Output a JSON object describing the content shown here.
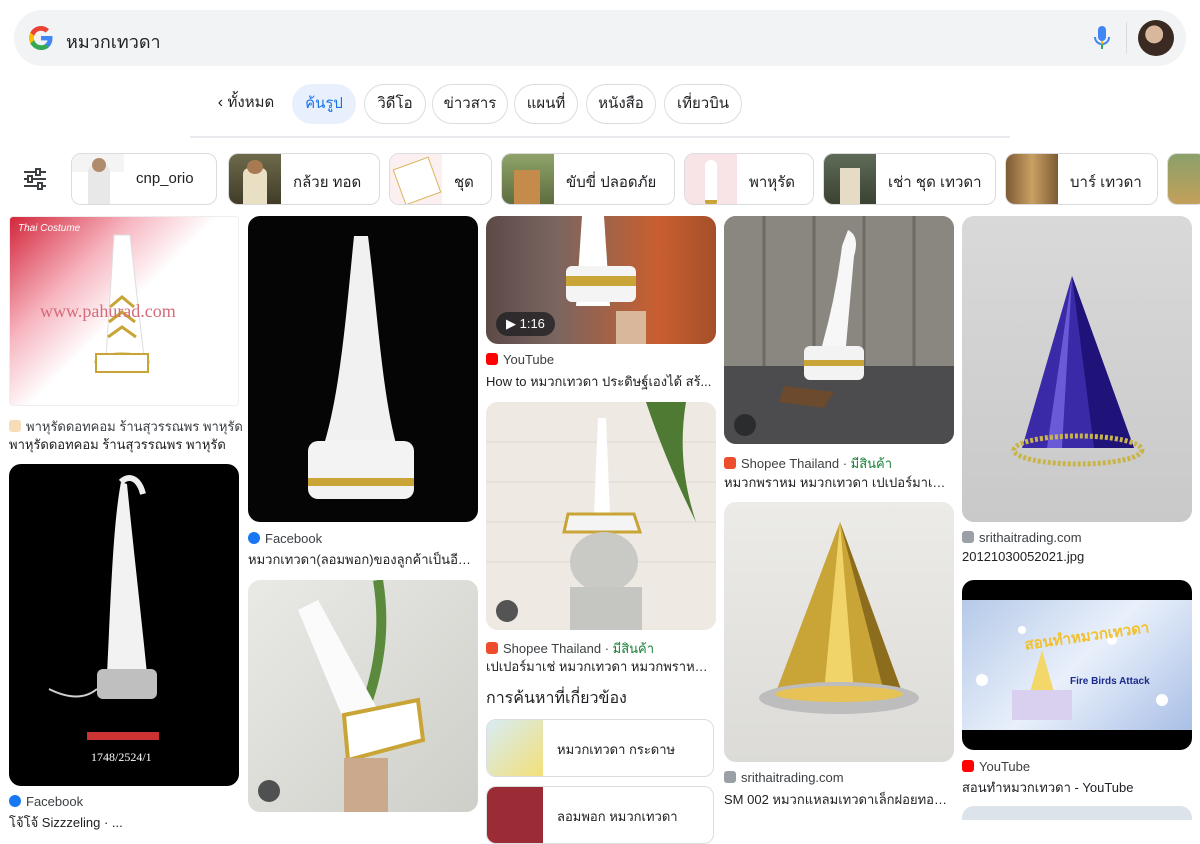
{
  "search": {
    "query": "หมวกเทวดา"
  },
  "tabs": [
    {
      "label": "ทั้งหมด"
    },
    {
      "label": "ค้นรูป"
    },
    {
      "label": "วิดีโอ"
    },
    {
      "label": "ข่าวสาร"
    },
    {
      "label": "แผนที่"
    },
    {
      "label": "หนังสือ"
    },
    {
      "label": "เที่ยวบิน"
    }
  ],
  "chips": [
    {
      "label": "cnp_orio"
    },
    {
      "label": "กล้วย ทอด"
    },
    {
      "label": "ชุด"
    },
    {
      "label": "ขับขี่ ปลอดภัย"
    },
    {
      "label": "พาหุรัด"
    },
    {
      "label": "เช่า ชุด เทวดา"
    },
    {
      "label": "บาร์ เทวดา"
    }
  ],
  "results": {
    "r1": {
      "source": "พาหุรัดดอทคอม ร้านสุวรรณพร พาหุรัด",
      "caption": "พาหุรัดดอทคอม ร้านสุวรรณพร พาหุรัด",
      "overlay_brand": "Thai Costume",
      "overlay_url": "www.pahurad.com"
    },
    "r2": {
      "source": "Facebook",
      "caption": "โจ้โจ้ Sizzzeling · ...",
      "overlay_code": "1748/2524/1"
    },
    "r3": {
      "source": "Facebook",
      "caption": "หมวกเทวดา(ลอมพอก)ของลูกค้าเป็นอีกห..."
    },
    "r5": {
      "source": "YouTube",
      "caption": "How to หมวกเทวดา ประดิษฐ์เองได้ สร้...",
      "duration": "1:16"
    },
    "r6": {
      "source": "Shopee Thailand",
      "stock": "มีสินค้า",
      "caption": "เปเปอร์มาเช่ หมวกเทวดา หมวกพราหม..."
    },
    "r7": {
      "source": "Shopee Thailand",
      "stock": "มีสินค้า",
      "caption": "หมวกพราหม หมวกเทวดา เปเปอร์มาเช่ |..."
    },
    "r8": {
      "source": "srithaitrading.com",
      "caption": "SM 002 หมวกแหลมเทวดาเล็กฝอยทอง ..."
    },
    "r9": {
      "source": "srithaitrading.com",
      "caption": "20121030052021.jpg"
    },
    "r10": {
      "source": "YouTube",
      "caption": "สอนทำหมวกเทวดา - YouTube",
      "overlay_title": "สอนทำหมวกเทวดา",
      "overlay_sub": "Fire Birds Attack"
    }
  },
  "related": {
    "title": "การค้นหาที่เกี่ยวข้อง",
    "items": [
      {
        "label": "หมวกเทวดา กระดาษ"
      },
      {
        "label": "ลอมพอก หมวกเทวดา"
      }
    ]
  },
  "colors": {
    "accent": "#1a73e8",
    "active_tab_bg": "#e8f0fe",
    "in_stock": "#188038",
    "youtube": "#ff0000",
    "facebook": "#1877f2",
    "shopee": "#ee4d2d"
  }
}
